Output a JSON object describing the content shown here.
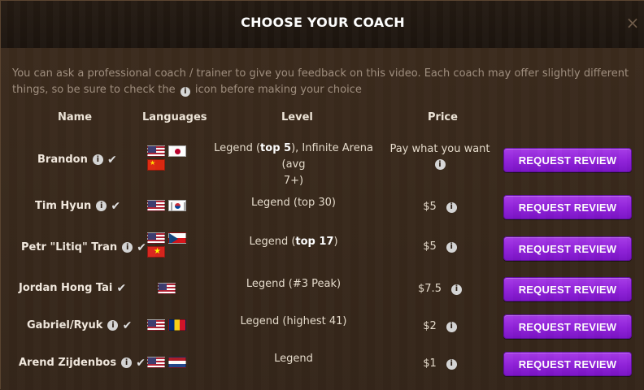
{
  "dialog": {
    "title": "CHOOSE YOUR COACH",
    "close_icon": "close-icon",
    "intro_text_before_icon": "You can ask a professional coach / trainer to give you feedback on this video. Each coach may offer slightly different things, so be sure to check the",
    "intro_text_after_icon": "icon before making your choice"
  },
  "table": {
    "headers": {
      "name": "Name",
      "languages": "Languages",
      "level": "Level",
      "price": "Price"
    },
    "rows": [
      {
        "name": "Brandon",
        "verified_icon": "check-icon",
        "info_icon": "info-icon",
        "flags": [
          [
            "us",
            "jp"
          ],
          [
            "cn"
          ]
        ],
        "level_parts": [
          "Legend (",
          "top 5",
          "), Infinite Arena (avg",
          "7+)"
        ],
        "price_line1": "Pay what you want",
        "price_info_icon": "info-icon",
        "button_label": "REQUEST REVIEW"
      },
      {
        "name": "Tim Hyun",
        "verified_icon": "check-icon",
        "info_icon": "info-icon",
        "flags": [
          [
            "us",
            "kr"
          ]
        ],
        "level": "Legend (top 30)",
        "price": "$5",
        "price_info_icon": "info-icon",
        "button_label": "REQUEST REVIEW"
      },
      {
        "name": "Petr \"Litiq\" Tran",
        "verified_icon": "check-icon",
        "info_icon": "info-icon",
        "flags": [
          [
            "us",
            "cz"
          ],
          [
            "vn"
          ]
        ],
        "level_parts": [
          "Legend (",
          "top 17",
          ")"
        ],
        "price": "$5",
        "price_info_icon": "info-icon",
        "button_label": "REQUEST REVIEW"
      },
      {
        "name": "Jordan Hong Tai",
        "verified_icon": "check-icon",
        "info_icon": "info-icon",
        "flags": [
          [
            "us"
          ]
        ],
        "level": "Legend (#3 Peak)",
        "price": "$7.5",
        "price_info_icon": "info-icon",
        "button_label": "REQUEST REVIEW"
      },
      {
        "name": "Gabriel/Ryuk",
        "verified_icon": "check-icon",
        "info_icon": "info-icon",
        "flags": [
          [
            "us",
            "ro"
          ]
        ],
        "level": "Legend (highest 41)",
        "price": "$2",
        "price_info_icon": "info-icon",
        "button_label": "REQUEST REVIEW"
      },
      {
        "name": "Arend Zijdenbos",
        "verified_icon": "check-icon",
        "info_icon": "info-icon",
        "flags": [
          [
            "us",
            "nl"
          ]
        ],
        "level": "Legend",
        "price": "$1",
        "price_info_icon": "info-icon",
        "button_label": "REQUEST REVIEW"
      }
    ]
  },
  "colors": {
    "button_purple": "#8f20d8",
    "text_primary": "#f2e9de",
    "text_muted": "#a08f7f",
    "background": "#3a2a1c"
  }
}
